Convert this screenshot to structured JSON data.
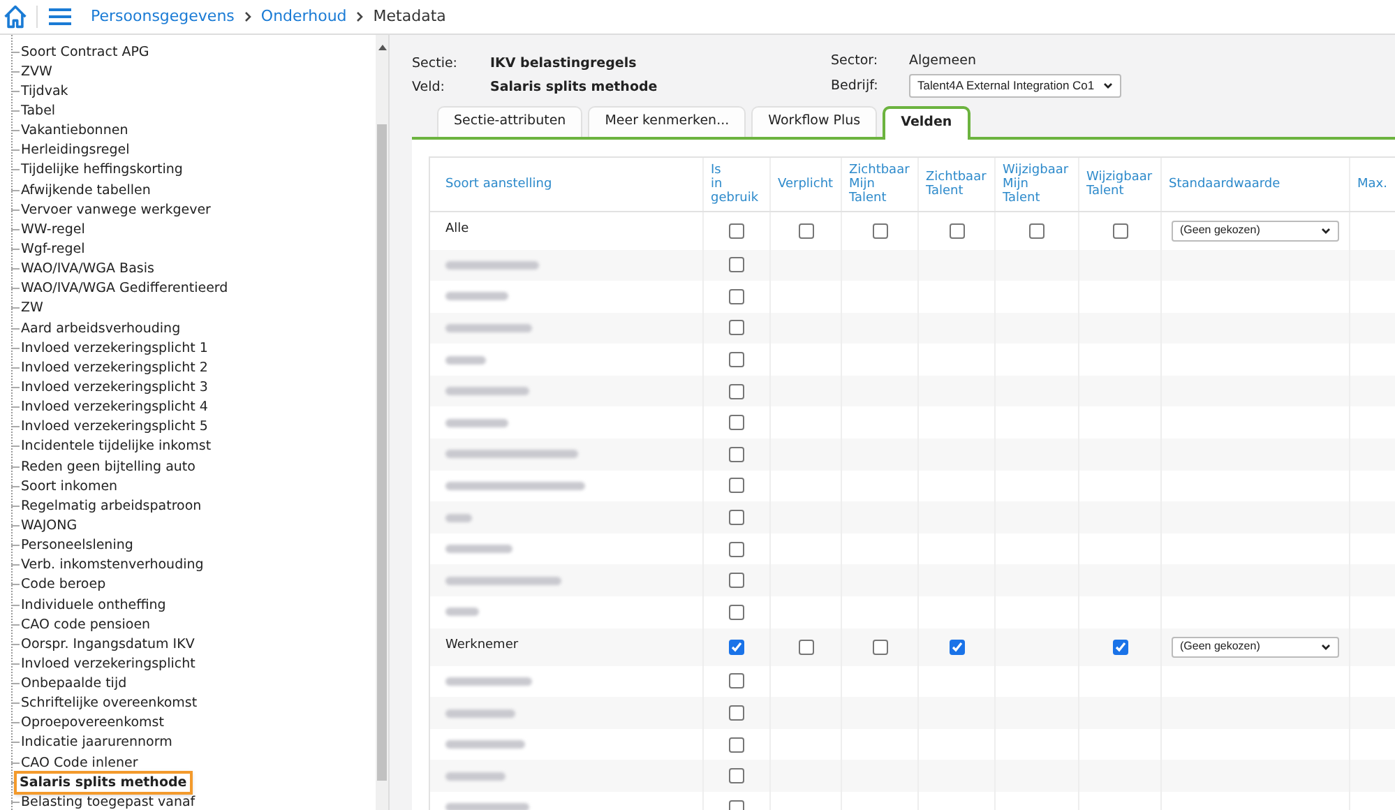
{
  "breadcrumb": [
    "Persoonsgegevens",
    "Onderhoud",
    "Metadata"
  ],
  "sidebar": {
    "items": [
      {
        "label": "Soort Contract APG",
        "selected": false
      },
      {
        "label": "ZVW",
        "selected": false
      },
      {
        "label": "Tijdvak",
        "selected": false
      },
      {
        "label": "Tabel",
        "selected": false
      },
      {
        "label": "Vakantiebonnen",
        "selected": false
      },
      {
        "label": "Herleidingsregel",
        "selected": false
      },
      {
        "label": "Tijdelijke heffingskorting",
        "selected": false
      },
      {
        "label": "Afwijkende tabellen",
        "selected": false
      },
      {
        "label": "Vervoer vanwege werkgever",
        "selected": false
      },
      {
        "label": "WW-regel",
        "selected": false
      },
      {
        "label": "Wgf-regel",
        "selected": false
      },
      {
        "label": "WAO/IVA/WGA Basis",
        "selected": false
      },
      {
        "label": "WAO/IVA/WGA Gedifferentieerd",
        "selected": false
      },
      {
        "label": "ZW",
        "selected": false
      },
      {
        "label": "Aard arbeidsverhouding",
        "selected": false
      },
      {
        "label": "Invloed verzekeringsplicht 1",
        "selected": false
      },
      {
        "label": "Invloed verzekeringsplicht 2",
        "selected": false
      },
      {
        "label": "Invloed verzekeringsplicht 3",
        "selected": false
      },
      {
        "label": "Invloed verzekeringsplicht 4",
        "selected": false
      },
      {
        "label": "Invloed verzekeringsplicht 5",
        "selected": false
      },
      {
        "label": "Incidentele tijdelijke inkomst",
        "selected": false
      },
      {
        "label": "Reden geen bijtelling auto",
        "selected": false
      },
      {
        "label": "Soort inkomen",
        "selected": false
      },
      {
        "label": "Regelmatig arbeidspatroon",
        "selected": false
      },
      {
        "label": "WAJONG",
        "selected": false
      },
      {
        "label": "Personeelslening",
        "selected": false
      },
      {
        "label": "Verb. inkomstenverhouding",
        "selected": false
      },
      {
        "label": "Code beroep",
        "selected": false
      },
      {
        "label": "Individuele ontheffing",
        "selected": false
      },
      {
        "label": "CAO code pensioen",
        "selected": false
      },
      {
        "label": "Oorspr. Ingangsdatum IKV",
        "selected": false
      },
      {
        "label": "Invloed verzekeringsplicht",
        "selected": false
      },
      {
        "label": "Onbepaalde tijd",
        "selected": false
      },
      {
        "label": "Schriftelijke overeenkomst",
        "selected": false
      },
      {
        "label": "Oproepovereenkomst",
        "selected": false
      },
      {
        "label": "Indicatie jaarurennorm",
        "selected": false
      },
      {
        "label": "CAO Code inlener",
        "selected": false
      },
      {
        "label": "Salaris splits methode",
        "selected": true
      },
      {
        "label": "Belasting toegepast vanaf",
        "selected": false
      }
    ]
  },
  "header": {
    "sectie_label": "Sectie:",
    "sectie": "IKV belastingregels",
    "veld_label": "Veld:",
    "veld": "Salaris splits methode",
    "sector_label": "Sector:",
    "sector": "Algemeen",
    "bedrijf_label": "Bedrijf:",
    "bedrijf": "Talent4A External Integration Co1"
  },
  "tabs": [
    {
      "label": "Sectie-attributen",
      "selected": false
    },
    {
      "label": "Meer kenmerken...",
      "selected": false
    },
    {
      "label": "Workflow Plus",
      "selected": false
    },
    {
      "label": "Velden",
      "selected": true
    }
  ],
  "table": {
    "columns": [
      "Soort aanstelling",
      "Is in gebruik",
      "Verplicht",
      "Zichtbaar Mijn Talent",
      "Zichtbaar Talent",
      "Wijzigbaar Mijn Talent",
      "Wijzigbaar Talent",
      "Standaardwaarde",
      "Max."
    ],
    "rows": [
      {
        "kind": "full",
        "label": "Alle",
        "cells": [
          {
            "kind": "checkbox",
            "checked": false
          },
          {
            "kind": "checkbox",
            "checked": false
          },
          {
            "kind": "checkbox",
            "checked": false
          },
          {
            "kind": "checkbox",
            "checked": false
          },
          {
            "kind": "checkbox",
            "checked": false
          },
          {
            "kind": "checkbox",
            "checked": false
          }
        ],
        "default": "(Geen gekozen)"
      },
      {
        "kind": "redacted",
        "cells": [
          {
            "kind": "checkbox",
            "checked": false
          }
        ]
      },
      {
        "kind": "redacted",
        "cells": [
          {
            "kind": "checkbox",
            "checked": false
          }
        ]
      },
      {
        "kind": "redacted",
        "cells": [
          {
            "kind": "checkbox",
            "checked": false
          }
        ]
      },
      {
        "kind": "redacted",
        "cells": [
          {
            "kind": "checkbox",
            "checked": false
          }
        ]
      },
      {
        "kind": "redacted",
        "cells": [
          {
            "kind": "checkbox",
            "checked": false
          }
        ]
      },
      {
        "kind": "redacted",
        "cells": [
          {
            "kind": "checkbox",
            "checked": false
          }
        ]
      },
      {
        "kind": "redacted",
        "cells": [
          {
            "kind": "checkbox",
            "checked": false
          }
        ]
      },
      {
        "kind": "redacted",
        "cells": [
          {
            "kind": "checkbox",
            "checked": false
          }
        ]
      },
      {
        "kind": "redacted",
        "cells": [
          {
            "kind": "checkbox",
            "checked": false
          }
        ]
      },
      {
        "kind": "redacted",
        "cells": [
          {
            "kind": "checkbox",
            "checked": false
          }
        ]
      },
      {
        "kind": "redacted",
        "cells": [
          {
            "kind": "checkbox",
            "checked": false
          }
        ]
      },
      {
        "kind": "redacted",
        "cells": [
          {
            "kind": "checkbox",
            "checked": false
          }
        ]
      },
      {
        "kind": "full",
        "label": "Werknemer",
        "cells": [
          {
            "kind": "checkbox",
            "checked": true
          },
          {
            "kind": "checkbox",
            "checked": false
          },
          {
            "kind": "checkbox",
            "checked": false
          },
          {
            "kind": "checkbox",
            "checked": true
          },
          {
            "kind": "empty"
          },
          {
            "kind": "checkbox",
            "checked": true
          }
        ],
        "default": "(Geen gekozen)"
      },
      {
        "kind": "redacted",
        "cells": [
          {
            "kind": "checkbox",
            "checked": false
          }
        ]
      },
      {
        "kind": "redacted",
        "cells": [
          {
            "kind": "checkbox",
            "checked": false
          }
        ]
      },
      {
        "kind": "redacted",
        "cells": [
          {
            "kind": "checkbox",
            "checked": false
          }
        ]
      },
      {
        "kind": "redacted",
        "cells": [
          {
            "kind": "checkbox",
            "checked": false
          }
        ]
      },
      {
        "kind": "redacted",
        "cells": [
          {
            "kind": "checkbox",
            "checked": false
          }
        ]
      }
    ]
  }
}
